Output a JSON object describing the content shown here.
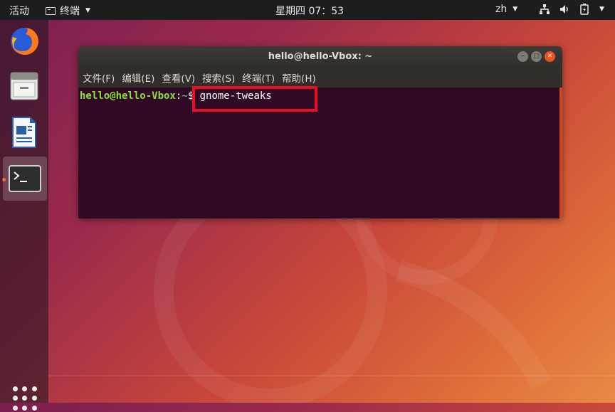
{
  "topbar": {
    "activities": "活动",
    "app_menu": "终端",
    "clock": "星期四 07：53",
    "language": "zh",
    "icons": [
      "network-icon",
      "volume-icon",
      "battery-icon"
    ]
  },
  "dock": {
    "items": [
      {
        "name": "firefox",
        "icon": "firefox-icon"
      },
      {
        "name": "files",
        "icon": "files-icon"
      },
      {
        "name": "libreoffice-writer",
        "icon": "writer-icon"
      },
      {
        "name": "terminal",
        "icon": "terminal-icon",
        "active": true
      }
    ],
    "show_apps_icon": "apps-grid-icon"
  },
  "terminal": {
    "title": "hello@hello-Vbox: ~",
    "menu": [
      "文件(F)",
      "编辑(E)",
      "查看(V)",
      "搜索(S)",
      "终端(T)",
      "帮助(H)"
    ],
    "prompt_user": "hello@hello-Vbox",
    "prompt_colon": ":",
    "prompt_path": "~",
    "prompt_symbol": "$ ",
    "command": "gnome-tweaks"
  },
  "colors": {
    "accent": "#e95420",
    "terminal_bg": "#300a24",
    "highlight": "#e81020"
  }
}
